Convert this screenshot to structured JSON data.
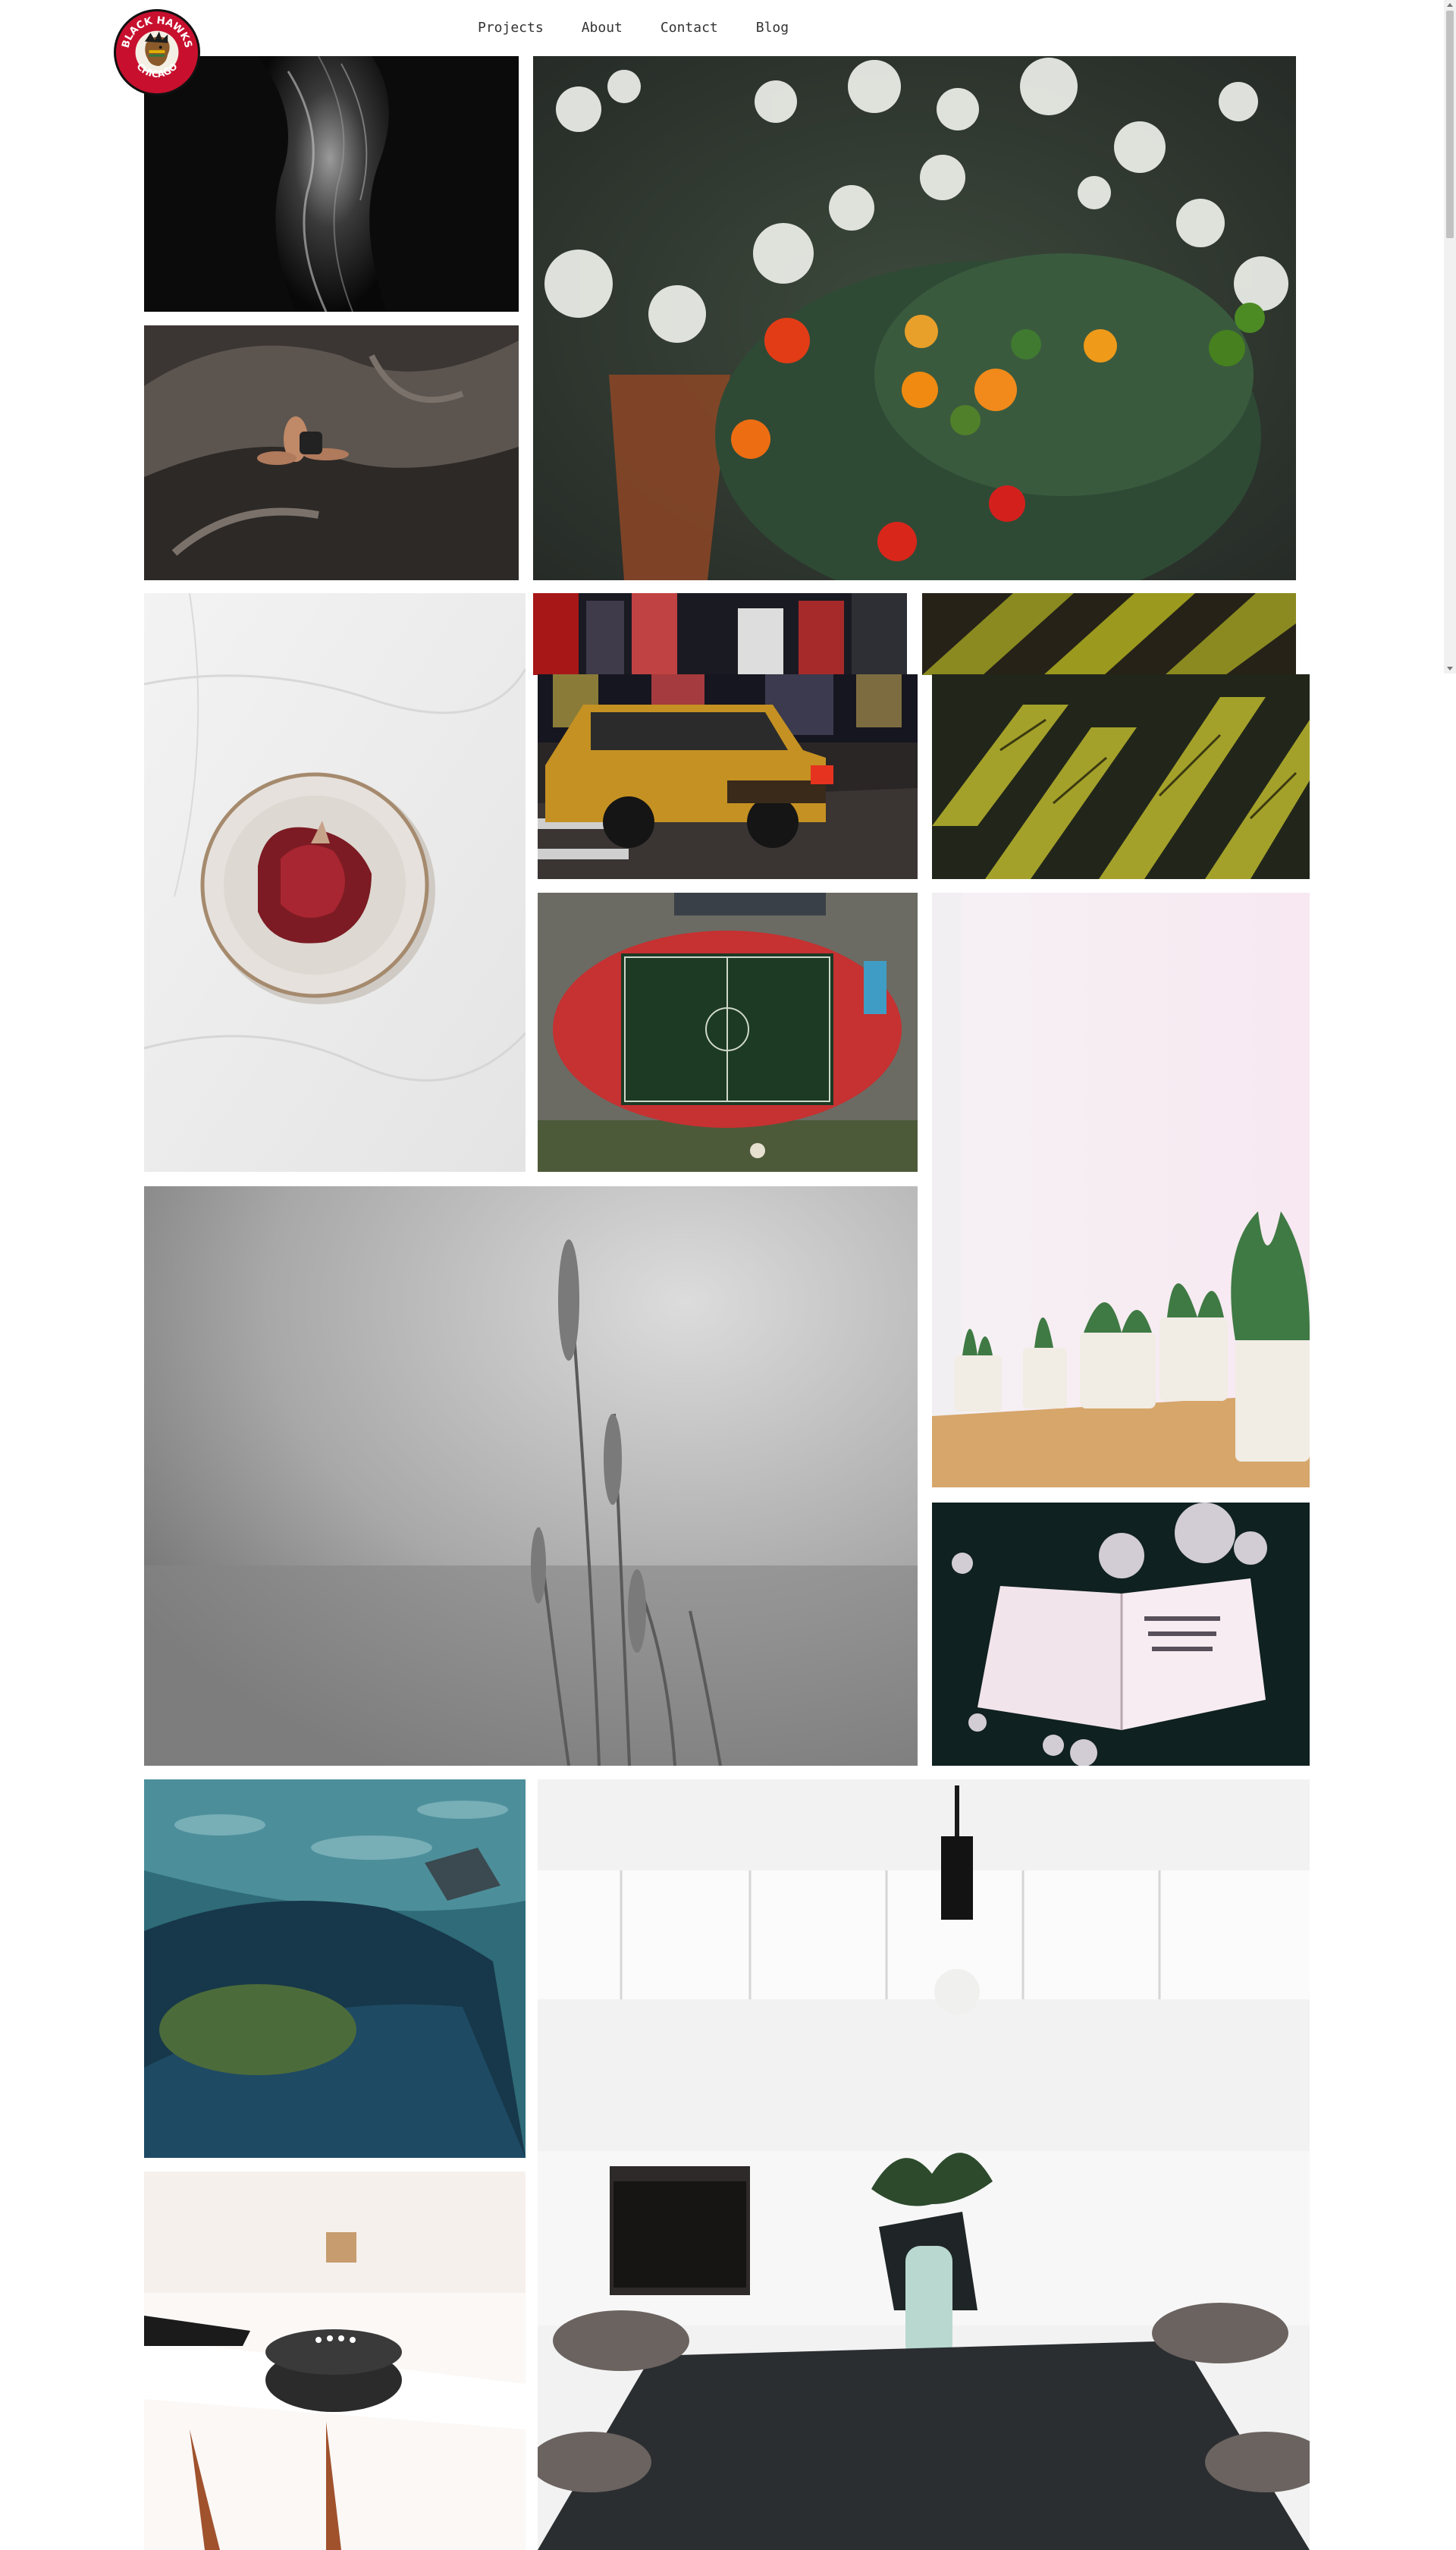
{
  "logo": {
    "line1": "BLACK HAWKS",
    "line2": "CHICAGO"
  },
  "nav": {
    "items": [
      {
        "label": "Projects"
      },
      {
        "label": "About"
      },
      {
        "label": "Contact"
      },
      {
        "label": "Blog"
      }
    ]
  },
  "gallery": {
    "photos": [
      {
        "subject": "canyon rock formation black and white"
      },
      {
        "subject": "red and orange berries with white flowers"
      },
      {
        "subject": "rock climber on cliff"
      },
      {
        "subject": "pomegranate on white plate"
      },
      {
        "subject": "yellow taxi on city street at night"
      },
      {
        "subject": "green fern leaves close-up"
      },
      {
        "subject": "aerial view of stadium running track"
      },
      {
        "subject": "potted succulents by window"
      },
      {
        "subject": "grass stalks black and white"
      },
      {
        "subject": "open book with fairy lights"
      },
      {
        "subject": "legs on rocks by ocean"
      },
      {
        "subject": "modern white kitchen with dining table"
      },
      {
        "subject": "smart speaker on white table"
      }
    ]
  },
  "colors": {
    "background": "#ffffff",
    "nav_text": "#333333",
    "logo_red": "#c8102e"
  }
}
